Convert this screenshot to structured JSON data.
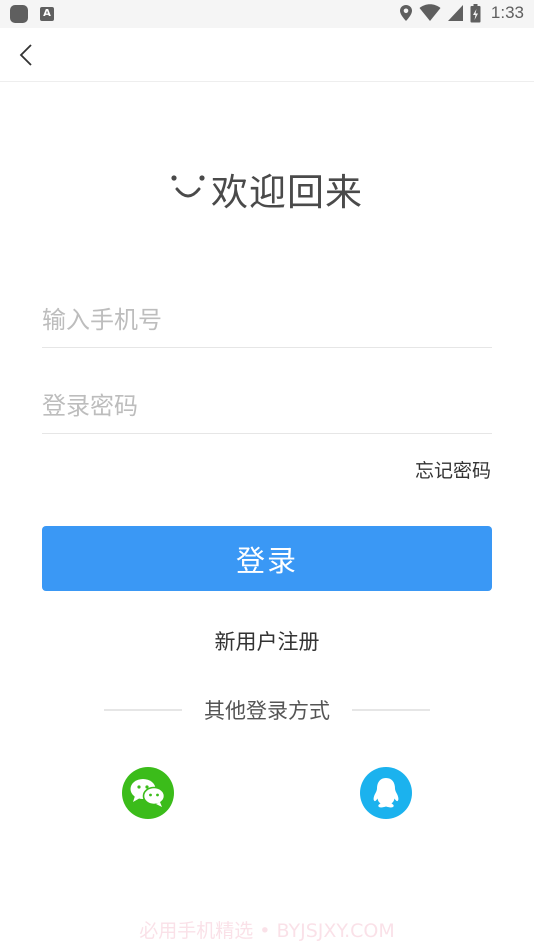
{
  "status_bar": {
    "time": "1:33",
    "notification_icons": [
      "app-notification-icon",
      "a-notification-icon"
    ],
    "system_icons": [
      "location-icon",
      "wifi-icon",
      "cellular-signal-icon",
      "battery-icon"
    ]
  },
  "nav": {
    "back_icon": "chevron-left-icon"
  },
  "welcome": {
    "icon": "smile-icon",
    "text": "欢迎回来"
  },
  "form": {
    "phone_placeholder": "输入手机号",
    "password_placeholder": "登录密码",
    "forgot_label": "忘记密码",
    "login_label": "登录"
  },
  "register_label": "新用户注册",
  "other_login": {
    "label": "其他登录方式",
    "providers": [
      {
        "icon": "wechat-icon",
        "color": "#3bbc1a"
      },
      {
        "icon": "qq-icon",
        "color": "#1bb2ee"
      }
    ]
  },
  "colors": {
    "primary": "#3a98f5",
    "wechat": "#3bbc1a",
    "qq": "#1bb2ee"
  },
  "watermark": "必用手机精选 • BYJSJXY.COM"
}
